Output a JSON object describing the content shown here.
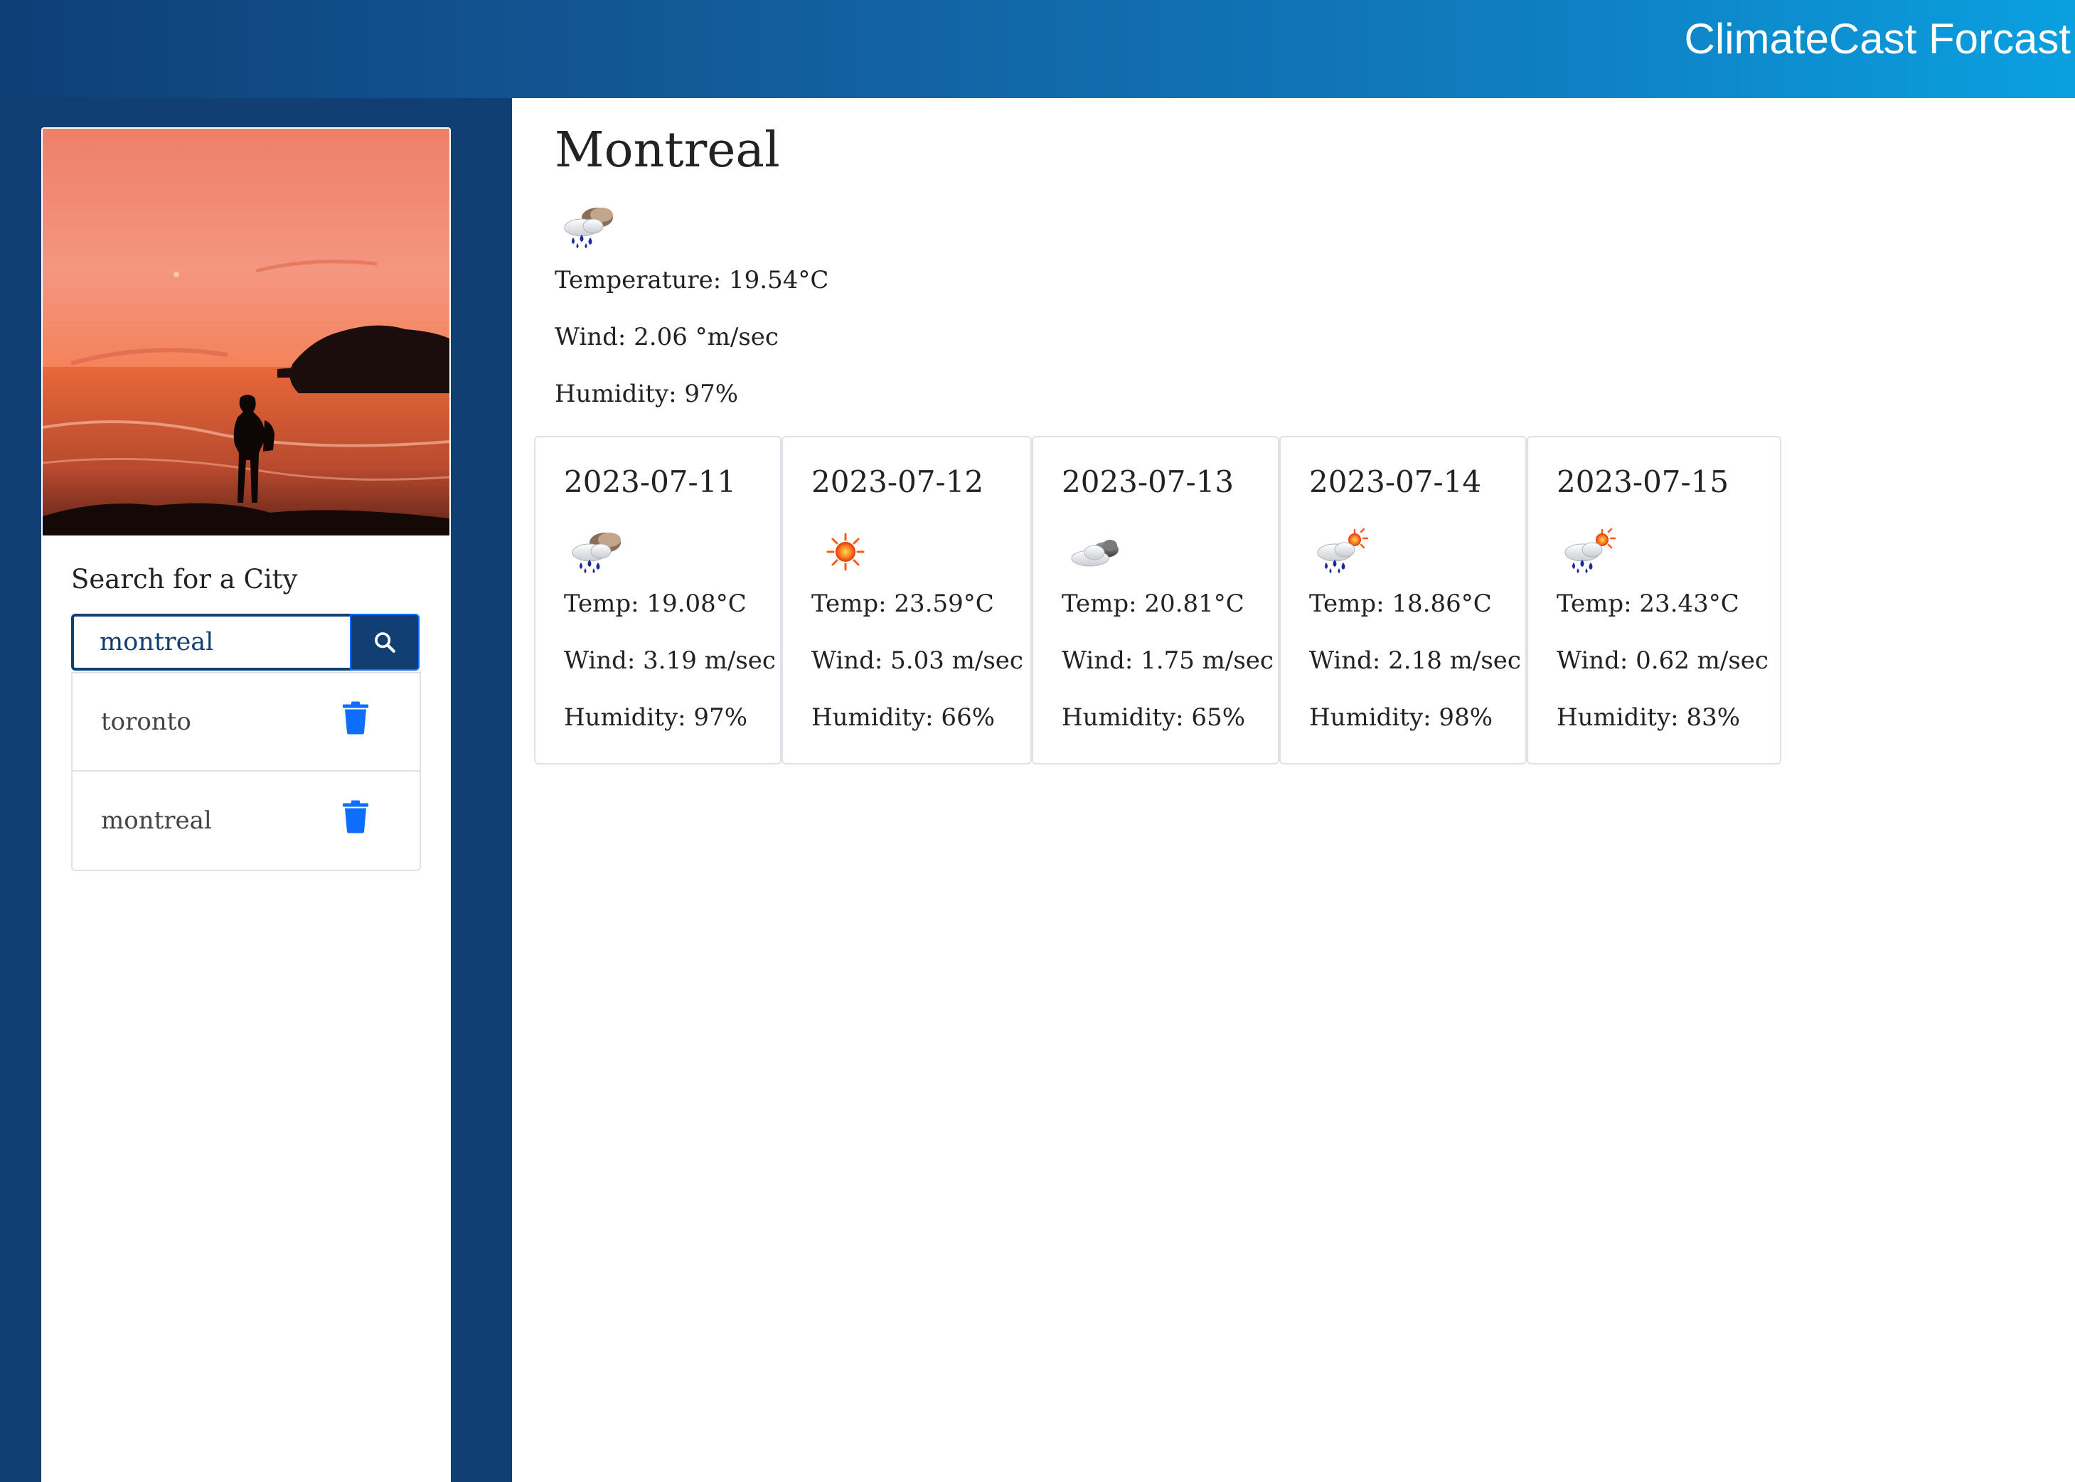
{
  "header": {
    "title": "ClimateCast Forcast"
  },
  "sidebar": {
    "image_alt": "Person silhouetted on a rocky shore at sunset",
    "search_label": "Search for a City",
    "search_value": "montreal",
    "search_icon": "search-icon",
    "history": [
      {
        "city": "toronto",
        "icon": "trash-icon"
      },
      {
        "city": "montreal",
        "icon": "trash-icon"
      }
    ]
  },
  "colors": {
    "brand_dark": "#123f73",
    "brand_light": "#0aa0e0",
    "trash": "#0d6efd"
  },
  "current": {
    "city": "Montreal",
    "icon": "rain-clouds-icon",
    "temperature": "Temperature: 19.54°C",
    "wind": "Wind: 2.06 °m/sec",
    "humidity": "Humidity: 97%"
  },
  "forecast": [
    {
      "date": "2023-07-11",
      "icon": "rain-clouds-icon",
      "temp": "Temp: 19.08°C",
      "wind": "Wind: 3.19 m/sec",
      "humidity": "Humidity: 97%"
    },
    {
      "date": "2023-07-12",
      "icon": "sun-icon",
      "temp": "Temp: 23.59°C",
      "wind": "Wind: 5.03 m/sec",
      "humidity": "Humidity: 66%"
    },
    {
      "date": "2023-07-13",
      "icon": "cloudy-icon",
      "temp": "Temp: 20.81°C",
      "wind": "Wind: 1.75 m/sec",
      "humidity": "Humidity: 65%"
    },
    {
      "date": "2023-07-14",
      "icon": "sun-rain-icon",
      "temp": "Temp: 18.86°C",
      "wind": "Wind: 2.18 m/sec",
      "humidity": "Humidity: 98%"
    },
    {
      "date": "2023-07-15",
      "icon": "sun-rain-icon",
      "temp": "Temp: 23.43°C",
      "wind": "Wind: 0.62 m/sec",
      "humidity": "Humidity: 83%"
    }
  ]
}
